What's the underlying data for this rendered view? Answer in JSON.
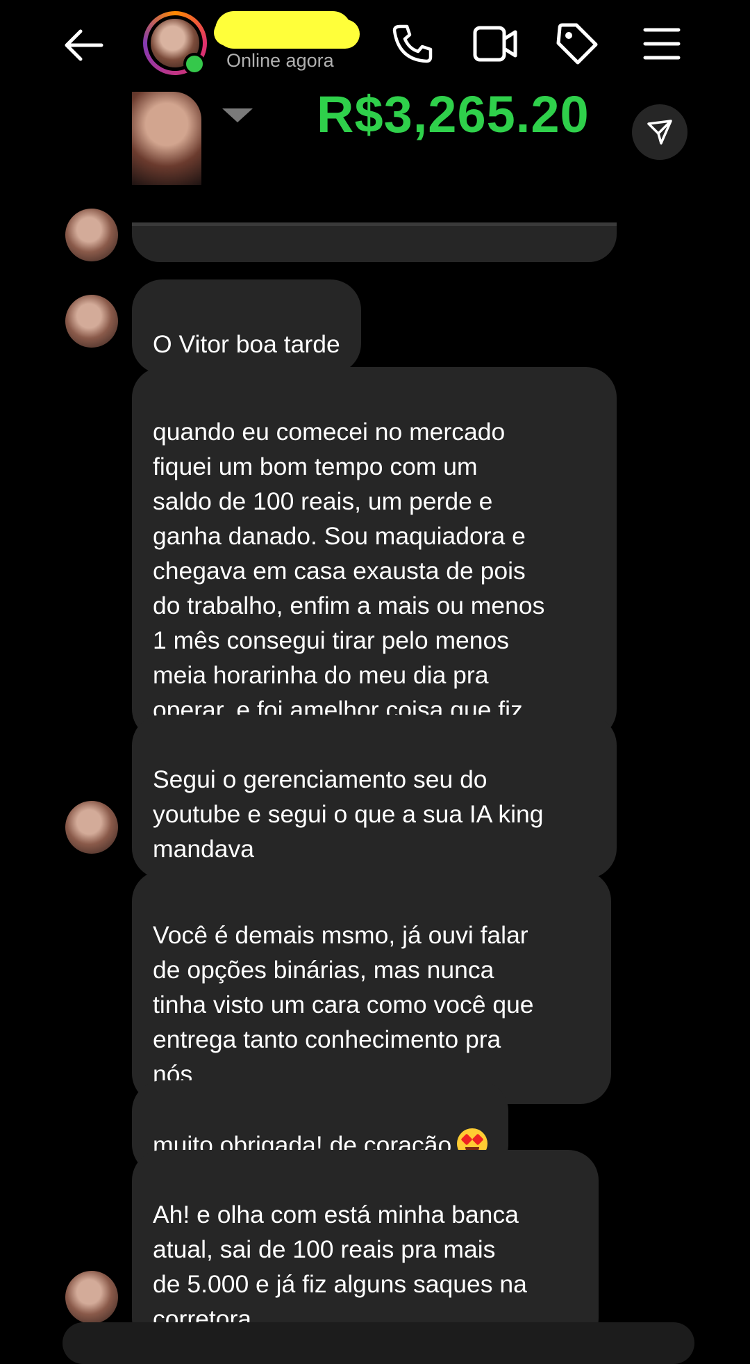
{
  "header": {
    "status": "Online agora",
    "icons": [
      "back-arrow-icon",
      "phone-icon",
      "video-camera-icon",
      "tag-icon",
      "menu-icon"
    ]
  },
  "shared_post": {
    "amount": "R$3,265.20",
    "share_icon": "send-icon"
  },
  "messages": [
    {
      "text": "O Vitor boa tarde"
    },
    {
      "text": "quando eu comecei no mercado\nfiquei um bom tempo com um\nsaldo de 100 reais, um perde e\nganha danado. Sou maquiadora e\nchegava em casa exausta de pois\ndo trabalho, enfim a mais ou menos\n1 mês  consegui tirar pelo menos\nmeia horarinha do meu dia pra\noperar, e foi amelhor coisa que fiz"
    },
    {
      "text": "Segui o gerenciamento seu do\nyoutube e segui o que a sua IA king\nmandava"
    },
    {
      "text": "Você é demais msmo, já ouvi falar\nde opções binárias, mas nunca\ntinha visto um cara como você que\nentrega tanto conhecimento pra\nnós"
    },
    {
      "text": "muito obrigada! de coração"
    },
    {
      "text": "Ah! e olha com está minha banca\natual, sai de 100 reais pra mais\nde 5.000 e já fiz alguns saques na\ncorretora"
    }
  ],
  "colors": {
    "background": "#000000",
    "bubble": "#262626",
    "amount_green": "#2fd04b",
    "online_green": "#35c84b"
  }
}
